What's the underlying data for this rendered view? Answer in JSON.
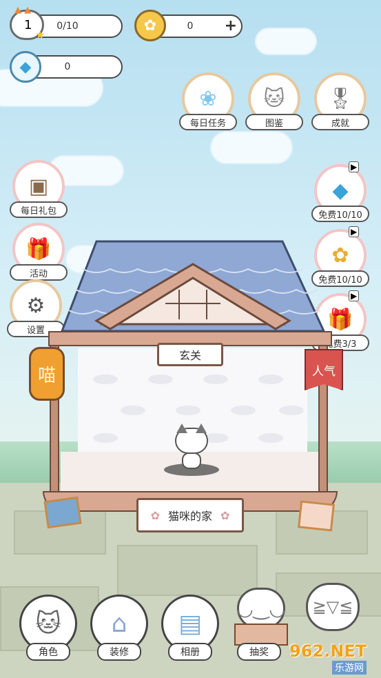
{
  "hud": {
    "level": "1",
    "exp": "0/10",
    "coins": "0",
    "gems": "0",
    "plus": "+"
  },
  "top_buttons": [
    {
      "label": "每日任务",
      "icon": "paw-icon"
    },
    {
      "label": "图鉴",
      "icon": "cat-face-icon"
    },
    {
      "label": "成就",
      "icon": "medal-icon"
    }
  ],
  "left_buttons": [
    {
      "label": "每日礼包",
      "icon": "treasure-chest-icon"
    },
    {
      "label": "活动",
      "icon": "gift-box-icon"
    },
    {
      "label": "设置",
      "icon": "gear-icon"
    }
  ],
  "right_buttons": [
    {
      "label": "免费10/10",
      "icon": "diamond-icon"
    },
    {
      "label": "免费10/10",
      "icon": "coin-icon"
    },
    {
      "label": "免费3/3",
      "icon": "gift-icon"
    }
  ],
  "house": {
    "room_name": "玄关",
    "house_name": "猫咪的家",
    "lantern_text": "喵",
    "banner_text": "人气"
  },
  "bottom_bar": [
    {
      "label": "角色",
      "icon": "cat-icon"
    },
    {
      "label": "装修",
      "icon": "house-icon"
    },
    {
      "label": "相册",
      "icon": "album-icon"
    },
    {
      "label": "抽奖",
      "icon": "lottery-cat-icon"
    }
  ],
  "watermark": {
    "top": "962.NET",
    "bottom": "乐游网"
  },
  "colors": {
    "roof": "#8fa8d4",
    "wood": "#c3907a",
    "ring": "#f3c5c5",
    "banner": "#d9534f",
    "lantern": "#f0a030"
  }
}
